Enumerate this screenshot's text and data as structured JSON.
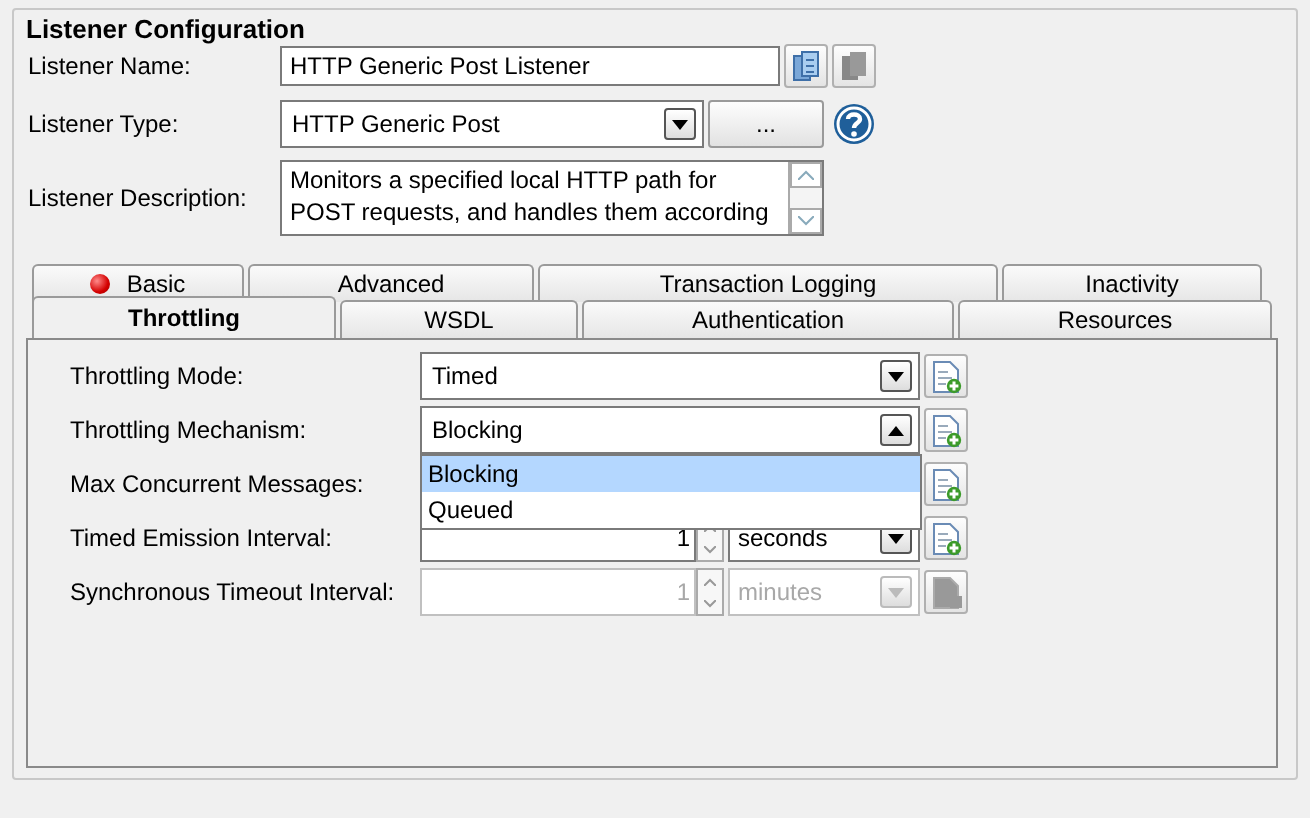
{
  "group": {
    "title": "Listener Configuration"
  },
  "fields": [
    {
      "kind": "text",
      "label": "Listener Name:",
      "value": "HTTP Generic Post Listener"
    },
    {
      "kind": "combo",
      "label": "Listener Type:",
      "value": "HTTP Generic Post",
      "button": "..."
    },
    {
      "kind": "textarea",
      "label": "Listener Description:",
      "lines": [
        "Monitors a specified local HTTP path for",
        "POST requests, and handles them according"
      ]
    }
  ],
  "tab_rows": [
    [
      {
        "label": "Basic",
        "selected": false,
        "error": true
      },
      {
        "label": "Advanced",
        "selected": false,
        "error": false
      },
      {
        "label": "Transaction Logging",
        "selected": false,
        "error": false
      },
      {
        "label": "Inactivity",
        "selected": false,
        "error": false
      }
    ],
    [
      {
        "label": "Throttling",
        "selected": true,
        "error": false
      },
      {
        "label": "WSDL",
        "selected": false,
        "error": false
      },
      {
        "label": "Authentication",
        "selected": false,
        "error": false
      },
      {
        "label": "Resources",
        "selected": false,
        "error": false
      }
    ]
  ],
  "throttling": [
    {
      "kind": "combo",
      "label": "Throttling Mode:",
      "value": "Timed",
      "expanded": false,
      "disabled": false
    },
    {
      "kind": "combo",
      "label": "Throttling Mechanism:",
      "value": "Blocking",
      "expanded": true,
      "disabled": false,
      "options": [
        {
          "label": "Blocking",
          "selected": true
        },
        {
          "label": "Queued",
          "selected": false
        }
      ]
    },
    {
      "kind": "covered",
      "label": "Max Concurrent Messages:",
      "disabled": false
    },
    {
      "kind": "spinner",
      "label": "Timed Emission Interval:",
      "value": "1",
      "unit": "seconds",
      "disabled": false
    },
    {
      "kind": "spinner",
      "label": "Synchronous Timeout Interval:",
      "value": "1",
      "unit": "minutes",
      "disabled": true
    }
  ]
}
